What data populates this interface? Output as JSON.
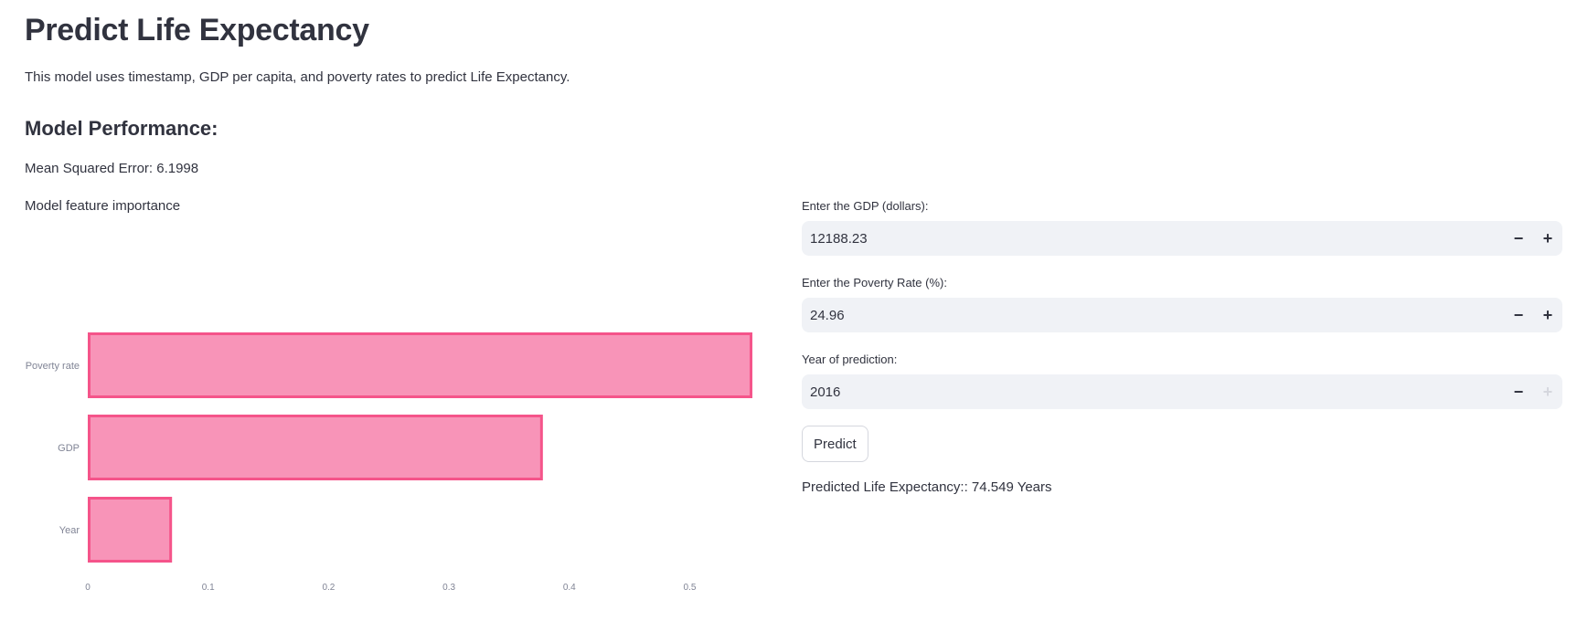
{
  "page": {
    "title": "Predict Life Expectancy",
    "description": "This model uses timestamp, GDP per capita, and poverty rates to predict Life Expectancy.",
    "performance_heading": "Model Performance:",
    "mse_text": "Mean Squared Error: 6.1998",
    "feature_importance_label": "Model feature importance"
  },
  "form": {
    "gdp": {
      "label": "Enter the GDP (dollars):",
      "value": "12188.23",
      "decrement": "−",
      "increment": "+"
    },
    "poverty": {
      "label": "Enter the Poverty Rate (%):",
      "value": "24.96",
      "decrement": "−",
      "increment": "+"
    },
    "year": {
      "label": "Year of prediction:",
      "value": "2016",
      "decrement": "−",
      "increment": "+",
      "increment_disabled": true
    },
    "predict_label": "Predict",
    "result_text": "Predicted Life Expectancy:: 74.549 Years"
  },
  "colors": {
    "bar_fill": "#f894b8",
    "bar_stroke": "#f5548a",
    "axis_text": "#808495"
  },
  "chart_data": {
    "type": "bar",
    "orientation": "horizontal",
    "title": "Model feature importance",
    "categories": [
      "Poverty rate",
      "GDP",
      "Year"
    ],
    "values": [
      0.552,
      0.378,
      0.07
    ],
    "xlabel": "",
    "ylabel": "",
    "xlim": [
      0,
      0.552
    ],
    "xticks": [
      0,
      0.1,
      0.2,
      0.3,
      0.4,
      0.5
    ],
    "xtick_labels": [
      "0",
      "0.1",
      "0.2",
      "0.3",
      "0.4",
      "0.5"
    ],
    "grid": false,
    "legend": "none"
  }
}
